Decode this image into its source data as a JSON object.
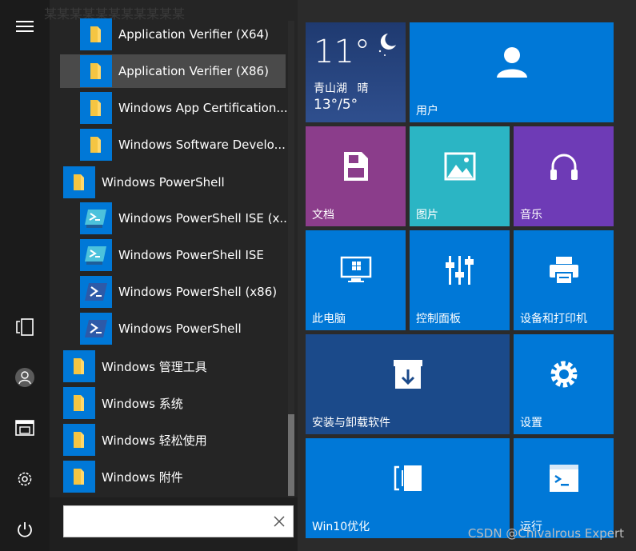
{
  "left_rail": {
    "menu_icon": "hamburger-menu-icon",
    "tablet_icon": "tablet-mode-icon",
    "user_icon": "user-avatar-icon",
    "file_icon": "file-explorer-icon",
    "settings_icon": "settings-gear-icon",
    "power_icon": "power-icon"
  },
  "app_list": {
    "faded_top_text": "某某某某某某某某某某某",
    "items": [
      {
        "label": "Application Verifier (X64)"
      },
      {
        "label": "Application Verifier (X86)"
      },
      {
        "label": "Windows App Certification..."
      },
      {
        "label": "Windows Software Develo..."
      },
      {
        "label": "Windows PowerShell"
      },
      {
        "label": "Windows PowerShell ISE (x..."
      },
      {
        "label": "Windows PowerShell ISE"
      },
      {
        "label": "Windows PowerShell (x86)"
      },
      {
        "label": "Windows PowerShell"
      },
      {
        "label": "Windows 管理工具"
      },
      {
        "label": "Windows 系统"
      },
      {
        "label": "Windows 轻松使用"
      },
      {
        "label": "Windows 附件"
      }
    ]
  },
  "search": {
    "value": "",
    "clear_icon": "close-x-icon"
  },
  "tiles": {
    "weather": {
      "temperature": "11°",
      "location": "青山湖",
      "condition": "晴",
      "range": "13°/5°"
    },
    "user": "用户",
    "documents": "文档",
    "pictures": "图片",
    "music": "音乐",
    "this_pc": "此电脑",
    "control_panel": "控制面板",
    "devices_printers": "设备和打印机",
    "install_uninstall": "安装与卸载软件",
    "settings": "设置",
    "win10": "Win10优化",
    "run": "运行"
  },
  "colors": {
    "tile_blue": "#0078d7",
    "tile_purple_doc": "#8b3d8b",
    "tile_teal": "#2bb5c4",
    "tile_violet": "#6e3bb6",
    "tile_navy": "#1b4a8a",
    "weather_bg": "#243f78"
  },
  "watermark": "CSDN @Chivalrous Expert"
}
